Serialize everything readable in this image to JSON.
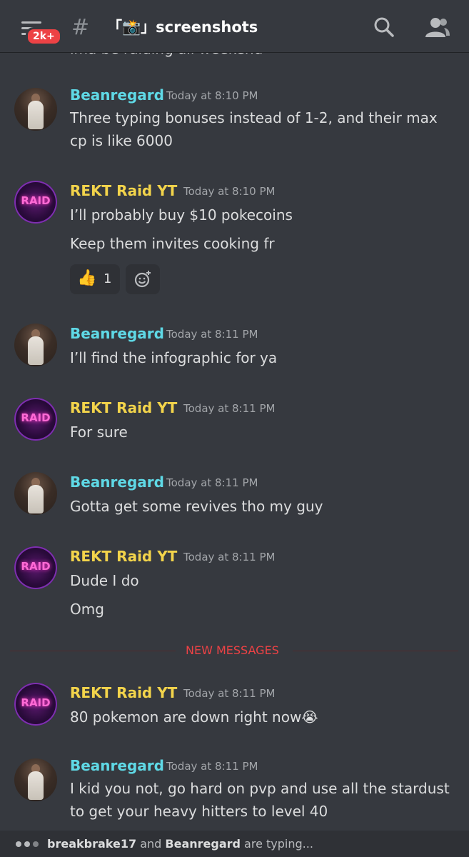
{
  "header": {
    "badge": "2k+",
    "hash": "#",
    "channel_name": "「📸」screenshots"
  },
  "cutoff_text": "ima be raiding all weekend",
  "messages": [
    {
      "author": "Beanregard",
      "time": "Today at 8:10 PM",
      "lines": [
        "Three typing bonuses instead of 1-2, and their max cp is like 6000"
      ]
    },
    {
      "author": "REKT Raid YT",
      "time": "Today at 8:10 PM",
      "lines": [
        "I’ll probably buy $10 pokecoins",
        "Keep them invites cooking fr"
      ],
      "reaction": {
        "emoji": "👍",
        "count": "1"
      }
    },
    {
      "author": "Beanregard",
      "time": "Today at 8:11 PM",
      "lines": [
        "I’ll find the infographic for ya"
      ]
    },
    {
      "author": "REKT Raid YT",
      "time": "Today at 8:11 PM",
      "lines": [
        "For sure"
      ]
    },
    {
      "author": "Beanregard",
      "time": "Today at 8:11 PM",
      "lines": [
        "Gotta get some revives tho my guy"
      ]
    },
    {
      "author": "REKT Raid YT",
      "time": "Today at 8:11 PM",
      "lines": [
        "Dude I do",
        "Omg"
      ]
    },
    {
      "author": "REKT Raid YT",
      "time": "Today at 8:11 PM",
      "lines": [
        "80 pokemon are down right now😭"
      ]
    },
    {
      "author": "Beanregard",
      "time": "Today at 8:11 PM",
      "lines": [
        "I kid you not, go hard on pvp and use all the stardust to get your heavy hitters to level 40"
      ]
    }
  ],
  "raid_avatar_text": "RAID",
  "new_messages_label": "NEW MESSAGES",
  "typing": {
    "user1": "breakbrake17",
    "joiner": " and ",
    "user2": "Beanregard",
    "suffix": " are typing..."
  },
  "colors": {
    "background": "#36393f",
    "beanregard_name": "#5fd9e6",
    "rekt_name": "#f3d44b",
    "new_messages": "#ed4245"
  }
}
